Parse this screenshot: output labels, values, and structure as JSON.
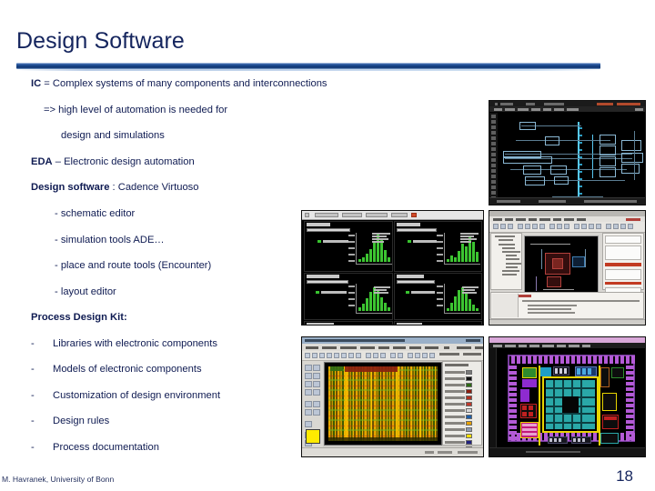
{
  "slide": {
    "title": "Design Software",
    "page_number": "18",
    "footer": "M. Havranek, University of Bonn",
    "accent_color": "#154284",
    "text_color": "#0f1b52"
  },
  "body": {
    "lines": [
      {
        "id": "ic-definition",
        "bold": "IC",
        "rest": " = Complex systems of many components and interconnections",
        "indent": "ind0"
      },
      {
        "id": "automation-need",
        "bold": "",
        "rest": "=> high level of automation is needed for",
        "indent": "ind1"
      },
      {
        "id": "design-and-simulations",
        "bold": "",
        "rest": "design and simulations",
        "indent": "ind2"
      },
      {
        "id": "eda-definition",
        "bold": "EDA",
        "rest": " – Electronic design automation",
        "indent": "ind0"
      },
      {
        "id": "design-software-tool",
        "bold": "Design software",
        "rest": " : Cadence Virtuoso",
        "indent": "ind0"
      }
    ],
    "tool_items": [
      {
        "id": "schematic-editor",
        "text": "- schematic editor"
      },
      {
        "id": "simulation-tools",
        "text": "- simulation tools ADE…"
      },
      {
        "id": "place-and-route",
        "text": "- place and route tools (Encounter)"
      },
      {
        "id": "layout-editor",
        "text": "- layout editor"
      }
    ],
    "pdk_heading": "Process Design Kit:",
    "pdk_items": [
      {
        "id": "libraries",
        "dash": "-",
        "text": "Libraries with electronic components"
      },
      {
        "id": "models",
        "dash": "-",
        "text": "Models of electronic components"
      },
      {
        "id": "customization",
        "dash": "-",
        "text": "Customization of design environment"
      },
      {
        "id": "design-rules",
        "dash": "-",
        "text": "Design rules"
      },
      {
        "id": "documentation",
        "dash": "-",
        "text": "Process documentation"
      }
    ]
  },
  "screenshots": [
    {
      "id": "schematic",
      "name": "virtuoso-schematic-editor-screenshot",
      "caption_ref": "schematic editor"
    },
    {
      "id": "ade",
      "name": "ade-simulation-results-screenshot",
      "caption_ref": "simulation tools ADE"
    },
    {
      "id": "layout",
      "name": "virtuoso-layout-editor-screenshot",
      "caption_ref": "layout editor"
    },
    {
      "id": "encounter",
      "name": "encounter-place-and-route-screenshot",
      "caption_ref": "place and route tools (Encounter)"
    },
    {
      "id": "chip",
      "name": "full-chip-layout-screenshot",
      "caption_ref": "layout editor"
    }
  ]
}
